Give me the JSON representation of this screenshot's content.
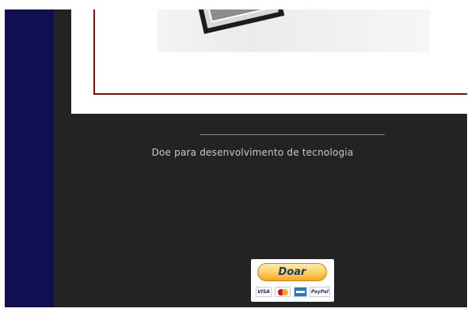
{
  "donation": {
    "message": "Doe para desenvolvimento de tecnologia",
    "button_label": "Doar",
    "cards": {
      "visa": "VISA",
      "paypal": "PayPal"
    }
  },
  "colors": {
    "sidebar": "#0f0f52",
    "panel": "#232323",
    "frame_border": "#7a1010",
    "donate_button": "#ffd46a",
    "text": "#c9c9c9"
  }
}
